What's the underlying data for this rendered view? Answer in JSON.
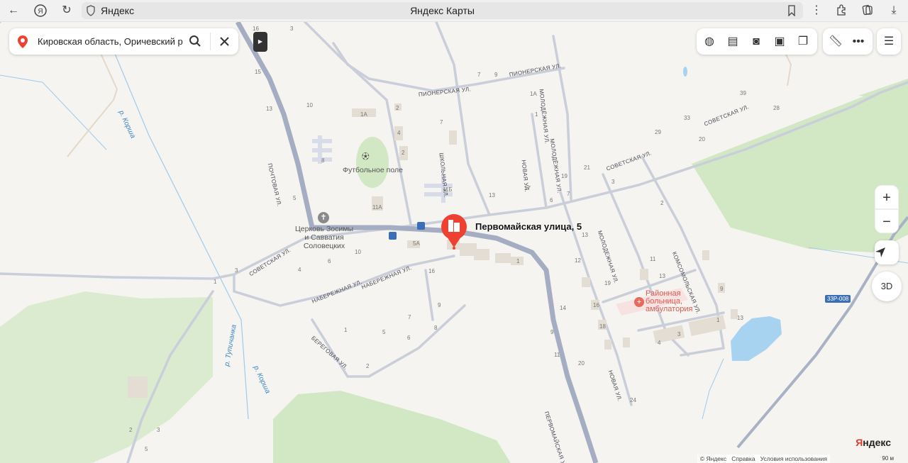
{
  "browser": {
    "url_text": "Яндекс",
    "page_title": "Яндекс Карты",
    "nav_icons": [
      "back-arrow-icon",
      "yandex-browser-icon",
      "reload-icon"
    ],
    "right_icons": [
      "bookmark-icon",
      "more-icon",
      "extensions-icon",
      "collections-icon",
      "download-icon"
    ]
  },
  "search": {
    "value": "Кировская область, Оричевский рай",
    "icons": [
      "map-pin-icon",
      "search-icon",
      "close-icon"
    ]
  },
  "toolbar": {
    "layers": [
      "panorama-icon",
      "guide-icon",
      "camera-icon",
      "bus-icon",
      "layers-icon"
    ],
    "tools": [
      "ruler-icon",
      "more-icon"
    ],
    "menu": "menu-icon"
  },
  "controls": {
    "zoom_in": "+",
    "zoom_out": "−",
    "locate": "locate-icon",
    "mode_3d": "3D"
  },
  "marker": {
    "label": "Первомайская улица, 5",
    "icon": "building-icon",
    "color": "#ef4132"
  },
  "pois": {
    "football": "Футбольное поле",
    "church_1": "Церковь Зосимы",
    "church_2": "и Савватия",
    "church_3": "Соловецких",
    "hospital_1": "Районная",
    "hospital_2": "больница,",
    "hospital_3": "амбулатория",
    "route": "33Р-008"
  },
  "streets": {
    "pionerskaya": "ПИОНЕРСКАЯ УЛ.",
    "pionerskaya2": "ПИОНЕРСКАЯ УЛ.",
    "pochtovaya": "ПОЧТОВАЯ УЛ.",
    "shkolnaya": "ШКОЛЬНАЯ УЛ.",
    "novaya": "НОВАЯ УЛ.",
    "novaya2": "НОВАЯ УЛ.",
    "molodezhnaya": "МОЛОДЁЖНАЯ УЛ.",
    "molodezhnaya2": "МОЛОДЁЖНАЯ УЛ.",
    "molodezhnaya3": "МОЛОДЕЖНАЯ УЛ.",
    "sovetskaya": "СОВЕТСКАЯ УЛ.",
    "sovetskaya2": "СОВЕТСКАЯ УЛ.",
    "sovetskaya3": "СОВЕТСКАЯ УЛ.",
    "komsomolskaya": "КОМСОМОЛЬСКАЯ УЛ.",
    "naberezhnaya": "НАБЕРЕЖНАЯ УЛ.",
    "naberezhnaya2": "НАБЕРЕЖНАЯ УЛ.",
    "beregovaya": "БЕРЕГОВАЯ УЛ.",
    "pervomayskaya": "ПЕРВОМАЙСКАЯ УЛ.",
    "river_korsha": "р. Корша",
    "river_korsha2": "р. Корша",
    "river_tupichanka": "р. Тупичанка"
  },
  "house_numbers": [
    "16",
    "3",
    "15",
    "13",
    "10",
    "1А",
    "2",
    "4",
    "2",
    "8",
    "7",
    "7",
    "9",
    "1А",
    "1",
    "11Б",
    "11А",
    "5",
    "13",
    "17",
    "6",
    "7",
    "19",
    "21",
    "29",
    "33",
    "39",
    "28",
    "20",
    "3",
    "2",
    "13",
    "12",
    "11",
    "13",
    "14",
    "9",
    "11",
    "20",
    "24",
    "16",
    "18",
    "19",
    "3",
    "4",
    "1",
    "9",
    "13",
    "10",
    "6",
    "4",
    "3",
    "1",
    "16",
    "9",
    "7",
    "8",
    "6",
    "5",
    "1",
    "2",
    "5А",
    "1",
    "2",
    "3",
    "5"
  ],
  "footer": {
    "copyright": "© Яндекс",
    "help": "Справка",
    "terms": "Условия использования",
    "logo_main": "Яндекс",
    "scale": "90 м"
  },
  "colors": {
    "main_road": "#a5adc2",
    "minor_road": "#c9ced9",
    "forest": "#d2e8c4",
    "water": "#a8d3f0",
    "background": "#f5f4f1",
    "marker": "#ef4132"
  }
}
